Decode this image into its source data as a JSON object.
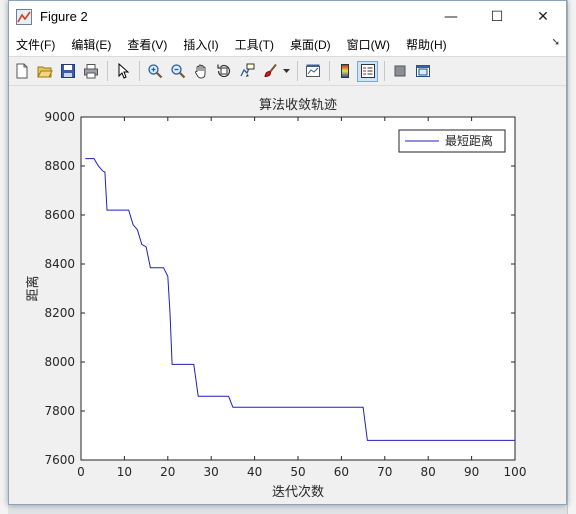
{
  "window": {
    "title": "Figure 2",
    "controls": {
      "minimize": "—",
      "maximize": "☐",
      "close": "✕"
    }
  },
  "menu": [
    {
      "label": "文件(F)"
    },
    {
      "label": "编辑(E)"
    },
    {
      "label": "查看(V)"
    },
    {
      "label": "插入(I)"
    },
    {
      "label": "工具(T)"
    },
    {
      "label": "桌面(D)"
    },
    {
      "label": "窗口(W)"
    },
    {
      "label": "帮助(H)"
    }
  ],
  "toolbar": [
    "new-figure-icon",
    "open-file-icon",
    "save-icon",
    "print-icon",
    "|",
    "edit-plot-arrow-icon",
    "|",
    "zoom-in-icon",
    "zoom-out-icon",
    "pan-hand-icon",
    "rotate-3d-icon",
    "data-cursor-icon",
    "brush-icon",
    "brush-dropdown-icon",
    "|",
    "link-plot-icon",
    "|",
    "colorbar-icon",
    "legend-icon",
    "|",
    "hide-plot-tools-icon",
    "show-plot-tools-icon"
  ],
  "chart_data": {
    "type": "line",
    "title": "算法收敛轨迹",
    "xlabel": "迭代次数",
    "ylabel": "距离",
    "xlim": [
      0,
      100
    ],
    "ylim": [
      7600,
      9000
    ],
    "xticks": [
      0,
      10,
      20,
      30,
      40,
      50,
      60,
      70,
      80,
      90,
      100
    ],
    "yticks": [
      7600,
      7800,
      8000,
      8200,
      8400,
      8600,
      8800,
      9000
    ],
    "legend_position": "top-right",
    "series": [
      {
        "name": "最短距离",
        "color": "#1f1fbf",
        "x": [
          1,
          3,
          4,
          5,
          5.5,
          6,
          11,
          12,
          13,
          14,
          15,
          16,
          17,
          19,
          20,
          20.5,
          21,
          26,
          27,
          34,
          35,
          65,
          66,
          100
        ],
        "y": [
          8830,
          8830,
          8800,
          8780,
          8775,
          8620,
          8620,
          8560,
          8540,
          8480,
          8470,
          8385,
          8385,
          8385,
          8350,
          8200,
          7990,
          7990,
          7860,
          7860,
          7815,
          7815,
          7680,
          7680
        ]
      }
    ]
  }
}
